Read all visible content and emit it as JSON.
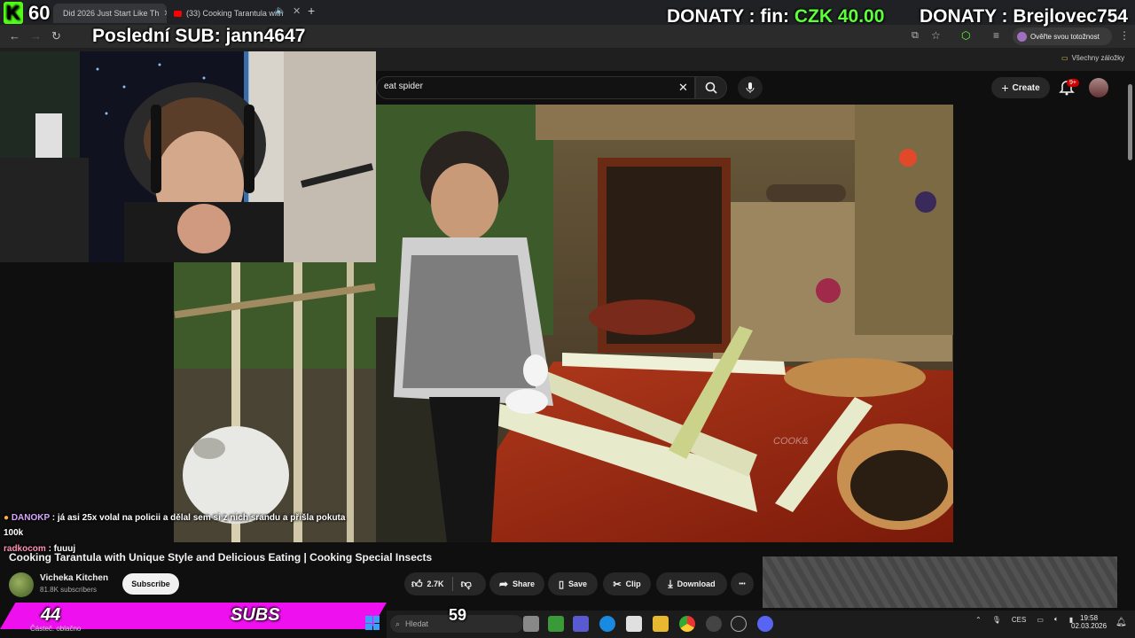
{
  "browser": {
    "tabs": [
      {
        "label": "Did 2026 Just Start Like Th"
      },
      {
        "label": "(33) Cooking Tarantula with"
      }
    ],
    "new_tab": "+",
    "profile_button": "Ověřte svou totožnost",
    "bookmarks_label": "Všechny záložky"
  },
  "youtube": {
    "search_value": "eat spider",
    "create_label": "Create",
    "notifications_badge": "9+",
    "video_title": "Cooking Tarantula with Unique Style and Delicious Eating | Cooking Special Insects",
    "channel_name": "Vicheka Kitchen",
    "channel_subs": "81.8K subscribers",
    "subscribe_label": "Subscribe",
    "like_count": "2.7K",
    "share_label": "Share",
    "save_label": "Save",
    "clip_label": "Clip",
    "download_label": "Download",
    "more_label": "•••",
    "watermark": "COOK&"
  },
  "overlay": {
    "kick_k": "K",
    "kick_count": "60",
    "last_sub": "Poslední SUB: jann4647",
    "donaty1_prefix": "DONATY : fin: ",
    "donaty1_amount": "CZK 40.00",
    "donaty2": "DONATY : Brejlovec754",
    "subs_count": "44",
    "subs_label": "SUBS",
    "follow_count": "59"
  },
  "chat": [
    {
      "user": "DANOKP",
      "text": " : já asi 25x volal na policii a dělal sem si z nich srandu a přišla pokuta"
    },
    {
      "user": "",
      "text": "100k"
    },
    {
      "user": "radkocom",
      "text": " : fuuuj"
    }
  ],
  "taskbar": {
    "search_placeholder": "Hledat",
    "lang": "CES",
    "time": "19:58",
    "date": "02.03.2026",
    "footer_text": "Částeč. oblačno"
  },
  "colors": {
    "kick_green": "#53fc18",
    "subs_magenta": "#ee10ee",
    "yt_red": "#cc0000"
  }
}
